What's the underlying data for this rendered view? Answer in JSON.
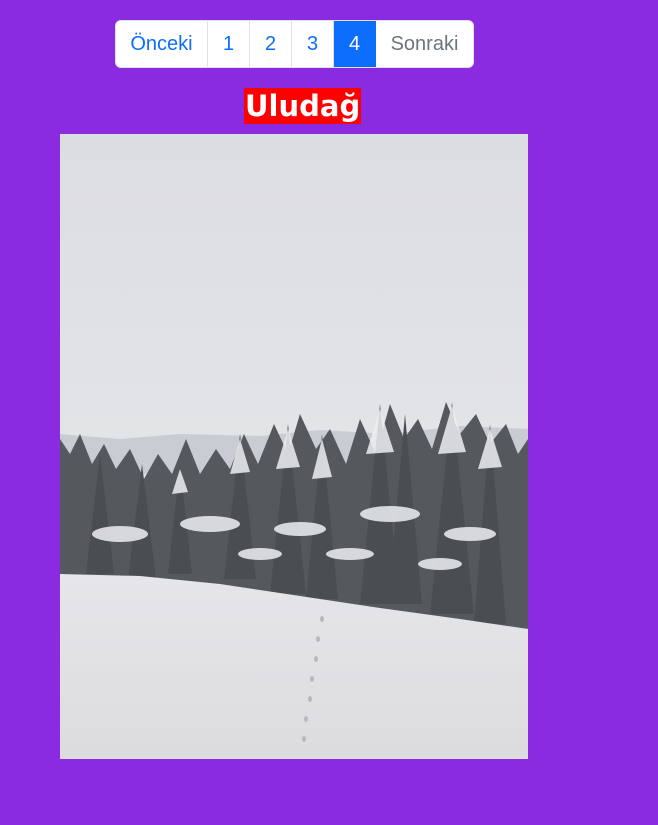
{
  "pagination": {
    "prev_label": "Önceki",
    "pages": [
      "1",
      "2",
      "3",
      "4"
    ],
    "active_page": "4",
    "next_label": "Sonraki"
  },
  "title": "Uludağ",
  "colors": {
    "background": "#8a2be2",
    "title_bg": "#ff0000",
    "link": "#0d6efd",
    "active_bg": "#0d6efd",
    "disabled_text": "#6c757d"
  },
  "image": {
    "subject": "snow-covered pine forest on a snowy slope under overcast sky"
  }
}
